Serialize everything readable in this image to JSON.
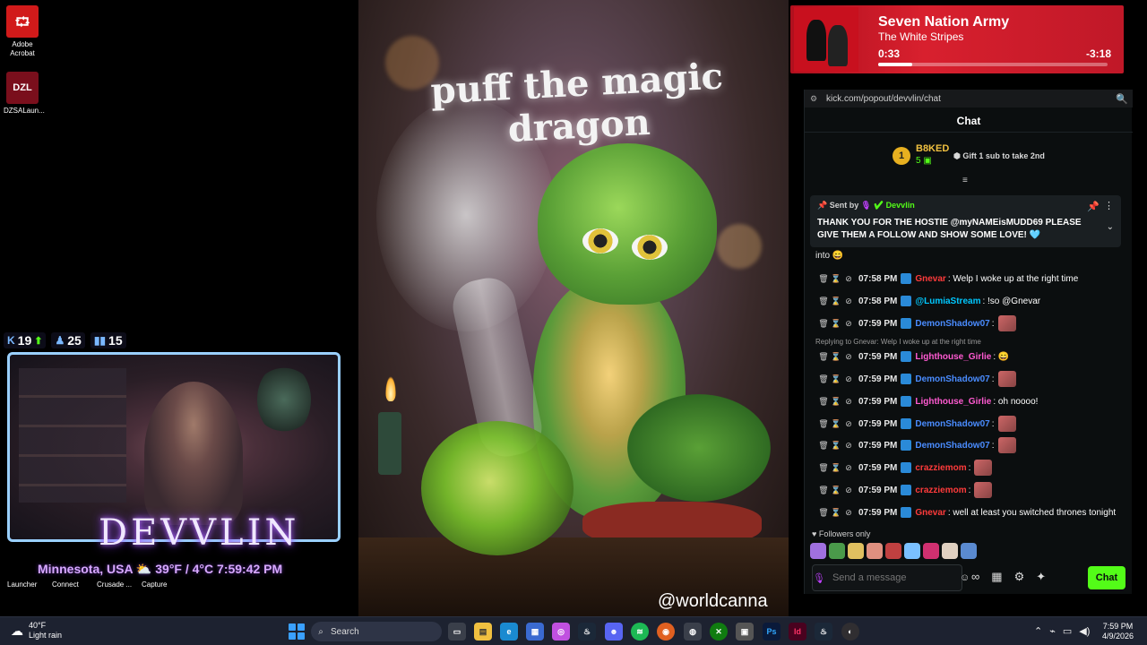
{
  "desktop_icons": [
    {
      "label": "Adobe Acrobat",
      "glyph": "A",
      "color": "#d11a1a"
    },
    {
      "label": "DZSALaun...",
      "glyph": "DZL",
      "color": "#7a0f1c"
    }
  ],
  "stream_stats": [
    {
      "icon": "kick-icon",
      "value": "19"
    },
    {
      "icon": "follower-icon",
      "value": "25"
    },
    {
      "icon": "viewers-icon",
      "value": "15"
    }
  ],
  "overlay": {
    "brand": "DEVVLIN",
    "weather": "Minnesota, USA ⛅ 39°F / 4°C 7:59:42 PM"
  },
  "dock": [
    "Launcher",
    "Connect",
    "Crusade ...",
    "Capture"
  ],
  "artwork": {
    "title": "puff the magic dragon",
    "credit": "@worldcanna"
  },
  "now_playing": {
    "title": "Seven Nation Army",
    "artist": "The White Stripes",
    "elapsed": "0:33",
    "remaining": "-3:18",
    "progress": 0.148
  },
  "browser": {
    "url": "kick.com/popout/devvlin/chat"
  },
  "chat": {
    "header": "Chat",
    "leaderboard": {
      "rank": "1",
      "name": "B8KED",
      "count": "5",
      "gift_text": "Gift 1 sub to take 2nd"
    },
    "pinned": {
      "sent_by": "Sent by",
      "sender": "Devvlin",
      "message": "THANK YOU FOR THE HOSTIE @myNAMEisMUDD69 PLEASE GIVE THEM A FOLLOW AND SHOW SOME LOVE! 🩵"
    },
    "partial_line": "into 😄",
    "reply_note": "Replying to Gnevar: Welp I woke up at the right time",
    "messages": [
      {
        "time": "07:58 PM",
        "user": "Gnevar",
        "color": "#ff3b3b",
        "text": ": Welp I woke up at the right time",
        "emote": false
      },
      {
        "time": "07:58 PM",
        "user": "@LumiaStream",
        "color": "#00c8ff",
        "text": ": !so @Gnevar",
        "emote": false
      },
      {
        "time": "07:59 PM",
        "user": "DemonShadow07",
        "color": "#4a8cff",
        "text": ":",
        "emote": true
      },
      {
        "time": "07:59 PM",
        "user": "Lighthouse_Girlie",
        "color": "#ff5ad1",
        "text": ": 😄",
        "emote": false
      },
      {
        "time": "07:59 PM",
        "user": "DemonShadow07",
        "color": "#4a8cff",
        "text": ":",
        "emote": true
      },
      {
        "time": "07:59 PM",
        "user": "Lighthouse_Girlie",
        "color": "#ff5ad1",
        "text": ": oh noooo!",
        "emote": false
      },
      {
        "time": "07:59 PM",
        "user": "DemonShadow07",
        "color": "#4a8cff",
        "text": ":",
        "emote": true
      },
      {
        "time": "07:59 PM",
        "user": "DemonShadow07",
        "color": "#4a8cff",
        "text": ":",
        "emote": true
      },
      {
        "time": "07:59 PM",
        "user": "crazziemom",
        "color": "#ff3b3b",
        "text": ":",
        "emote": true
      },
      {
        "time": "07:59 PM",
        "user": "crazziemom",
        "color": "#ff3b3b",
        "text": ":",
        "emote": true
      },
      {
        "time": "07:59 PM",
        "user": "Gnevar",
        "color": "#ff3b3b",
        "text": ": well at least you switched thrones tonight",
        "emote": false
      }
    ],
    "followers_only": "Followers only",
    "composer_placeholder": "Send a message",
    "send_label": "Chat",
    "accent": "#53fc18"
  },
  "taskbar": {
    "temperature": "40°F",
    "condition": "Light rain",
    "search_placeholder": "Search",
    "time": "7:59 PM",
    "date": "4/9/2026",
    "apps": [
      "file-explorer",
      "edge",
      "store",
      "copilot",
      "steam",
      "discord",
      "spotify",
      "firefox",
      "chrome",
      "xbox",
      "capture",
      "photoshop",
      "indesign",
      "steam-alt",
      "obs"
    ]
  }
}
